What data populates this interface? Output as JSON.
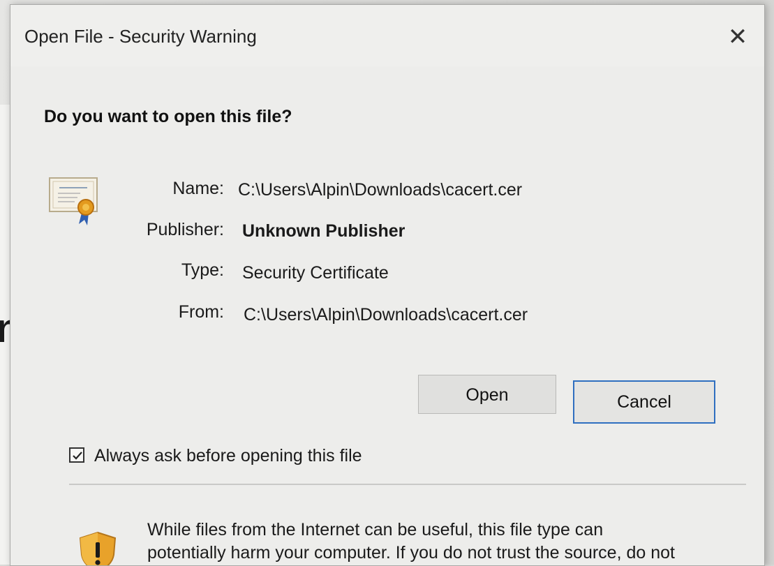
{
  "dialog": {
    "title": "Open File - Security Warning",
    "close_symbol": "✕",
    "heading": "Do you want to open this file?",
    "fields": [
      {
        "label": "Name:",
        "value": "C:\\Users\\Alpin\\Downloads\\cacert.cer",
        "bold": false
      },
      {
        "label": "Publisher:",
        "value": "Unknown Publisher",
        "bold": true
      },
      {
        "label": "Type:",
        "value": "Security Certificate",
        "bold": false
      },
      {
        "label": "From:",
        "value": "C:\\Users\\Alpin\\Downloads\\cacert.cer",
        "bold": false
      }
    ],
    "buttons": {
      "open_label": "Open",
      "cancel_label": "Cancel"
    },
    "checkbox": {
      "label": "Always ask before opening this file",
      "checked": true
    },
    "warning": {
      "line1": "While files from the Internet can be useful, this file type can",
      "line2": "potentially harm your computer. If you do not trust the source, do not"
    },
    "icons": {
      "file": "certificate-icon",
      "warning": "shield-warning-icon",
      "close": "close-icon"
    },
    "colors": {
      "default_button_border": "#2f6fc0"
    }
  },
  "background": {
    "text_fragment": "ni"
  }
}
